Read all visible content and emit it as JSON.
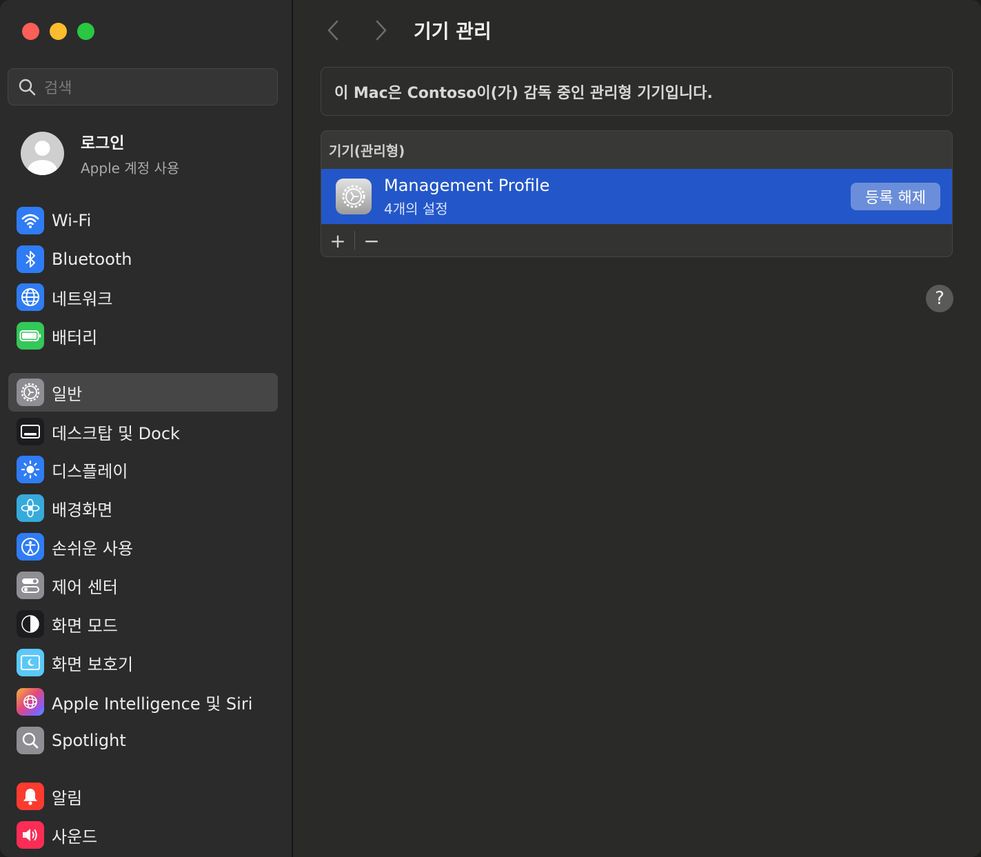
{
  "sidebar": {
    "search_placeholder": "검색",
    "account": {
      "name": "로그인",
      "subtitle": "Apple 계정 사용"
    },
    "items": [
      {
        "label": "Wi-Fi",
        "icon": "wifi-icon",
        "color": "#2f7cf6"
      },
      {
        "label": "Bluetooth",
        "icon": "bluetooth-icon",
        "color": "#2f7cf6"
      },
      {
        "label": "네트워크",
        "icon": "globe-icon",
        "color": "#2f7cf6"
      },
      {
        "label": "배터리",
        "icon": "battery-icon",
        "color": "#34c759"
      },
      {
        "label": "일반",
        "icon": "gear-icon",
        "color": "#8e8e93"
      },
      {
        "label": "데스크탑 및 Dock",
        "icon": "dock-icon",
        "color": "#1c1c1e"
      },
      {
        "label": "디스플레이",
        "icon": "sun-icon",
        "color": "#2f7cf6"
      },
      {
        "label": "배경화면",
        "icon": "flower-icon",
        "color": "#37aadc"
      },
      {
        "label": "손쉬운 사용",
        "icon": "accessibility-icon",
        "color": "#2f7cf6"
      },
      {
        "label": "제어 센터",
        "icon": "toggles-icon",
        "color": "#8e8e93"
      },
      {
        "label": "화면 모드",
        "icon": "appearance-icon",
        "color": "#1c1c1e"
      },
      {
        "label": "화면 보호기",
        "icon": "screensaver-icon",
        "color": "#5ac8fa"
      },
      {
        "label": "Apple Intelligence 및 Siri",
        "icon": "siri-icon",
        "color": "#c26bf2"
      },
      {
        "label": "Spotlight",
        "icon": "magnifier-icon",
        "color": "#8e8e93"
      },
      {
        "label": "알림",
        "icon": "bell-icon",
        "color": "#ff3b30"
      },
      {
        "label": "사운드",
        "icon": "speaker-icon",
        "color": "#ff2d55"
      }
    ]
  },
  "content": {
    "title": "기기 관리",
    "info_text": "이 Mac은 Contoso이(가) 감독 중인 관리형 기기입니다.",
    "devices_header": "기기(관리형)",
    "profile": {
      "name": "Management Profile",
      "subtitle": "4개의 설정",
      "button_label": "등록 해제"
    },
    "add_label": "+",
    "remove_label": "−",
    "help_label": "?"
  }
}
